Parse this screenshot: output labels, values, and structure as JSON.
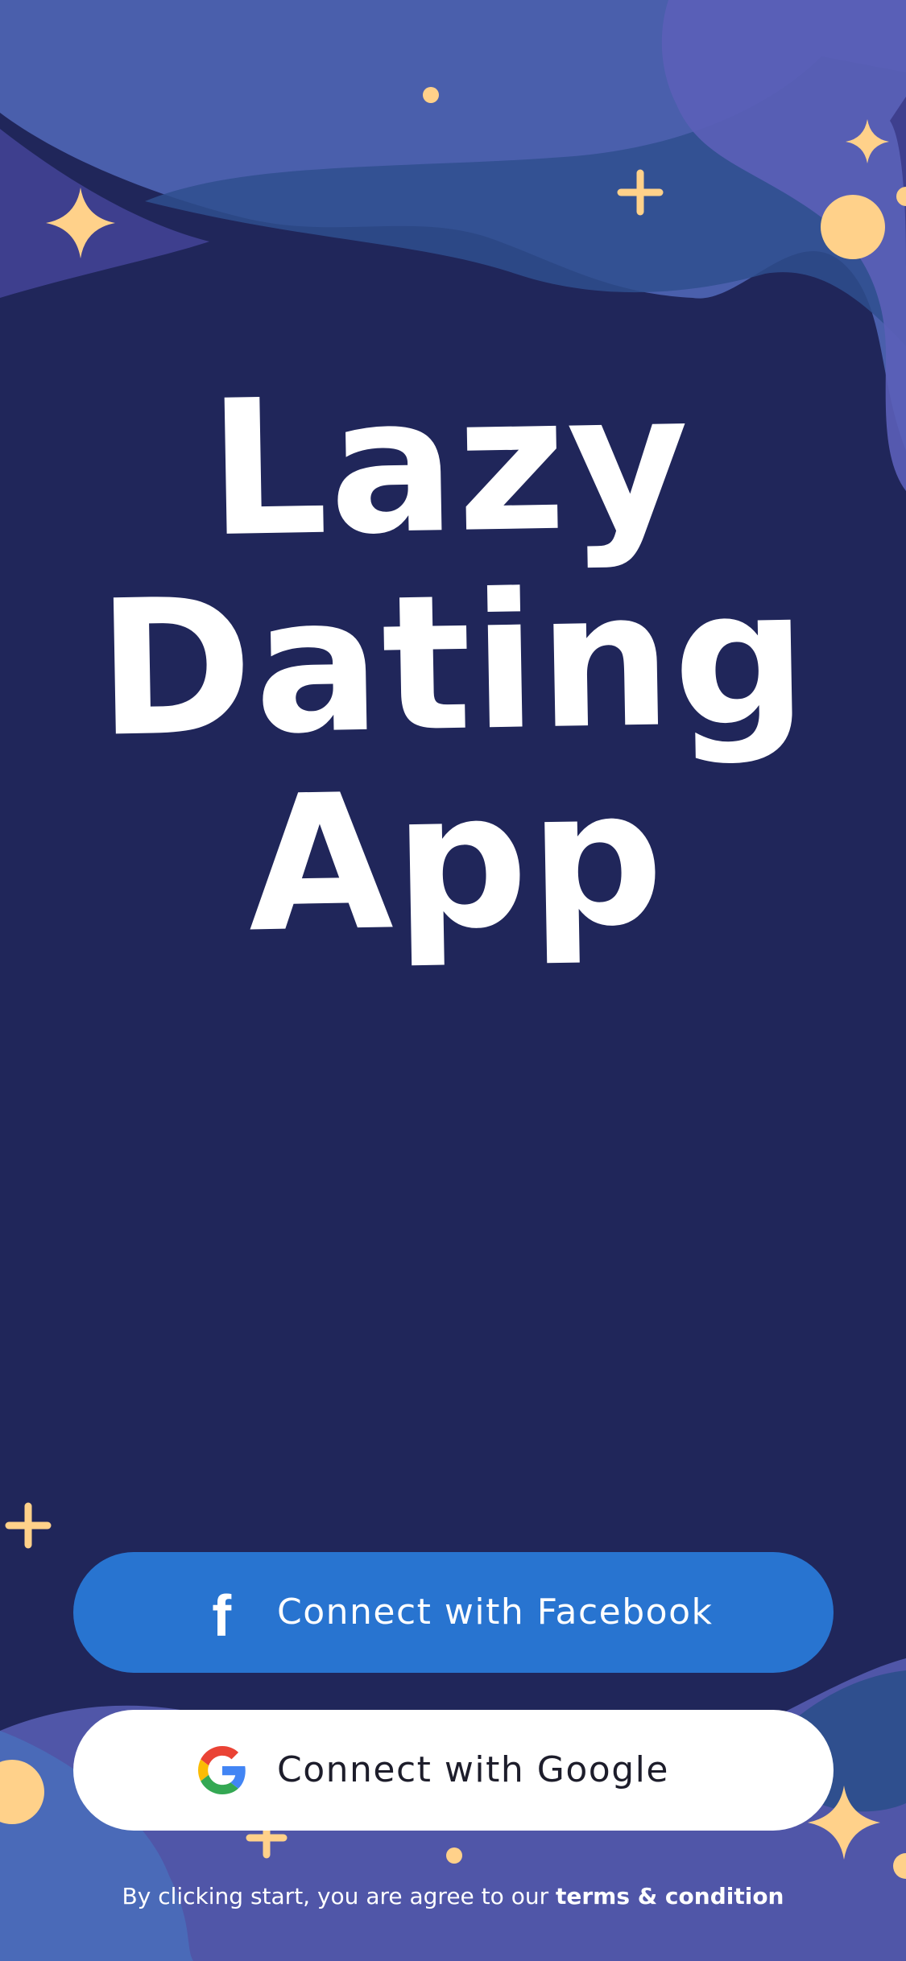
{
  "colors": {
    "background": "#20265a",
    "wave_primary": "#4a5fac",
    "wave_secondary": "#5b5fb8",
    "wave_dark": "#2f4f8e",
    "accent_yellow": "#ffd18a",
    "facebook_blue": "#2874d0",
    "button_white": "#ffffff"
  },
  "title_lines": [
    "Lazy",
    "Dating",
    "App"
  ],
  "buttons": {
    "facebook": {
      "label": "Connect with Facebook",
      "icon": "facebook-f-icon"
    },
    "google": {
      "label": "Connect with Google",
      "icon": "google-g-icon"
    }
  },
  "legal": {
    "prefix": "By clicking start, you are agree to our ",
    "link": "terms & condition"
  },
  "decorations": [
    "sparkle-icon",
    "plus-icon",
    "dot-icon",
    "circle-icon"
  ]
}
